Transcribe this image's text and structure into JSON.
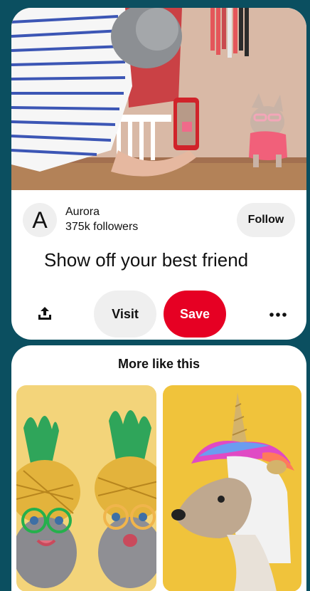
{
  "pin": {
    "image_icon": "photo-woman-photographing-sphynx-cat",
    "creator": {
      "avatar_letter": "A",
      "name": "Aurora",
      "followers": "375k followers"
    },
    "follow_label": "Follow",
    "title": "Show off your best friend",
    "actions": {
      "share_icon": "share-icon",
      "visit_label": "Visit",
      "save_label": "Save",
      "more_icon": "more-icon"
    }
  },
  "more_like_this": {
    "title": "More like this",
    "items": [
      {
        "image_icon": "photo-kittens-in-pineapple-hats"
      },
      {
        "image_icon": "photo-greyhound-unicorn-costume"
      }
    ]
  },
  "colors": {
    "background": "#0b4f60",
    "save": "#e60023",
    "neutral_button": "#efefef"
  }
}
